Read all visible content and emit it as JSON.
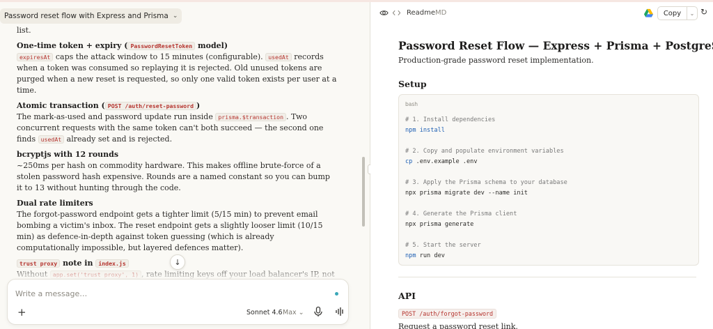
{
  "chat": {
    "title": "Password reset flow with Express and Prisma",
    "fragment": "list.",
    "sections": [
      {
        "heading_before": "One-time token + expiry (",
        "heading_code": "PasswordResetToken",
        "heading_after": " model)",
        "body": [
          {
            "code": "expiresAt"
          },
          {
            "text": " caps the attack window to 15 minutes (configurable). "
          },
          {
            "code": "usedAt"
          },
          {
            "text": " records when a token was consumed so replaying it is rejected. Old unused tokens are purged when a new reset is requested, so only one valid token exists per user at a time."
          }
        ]
      },
      {
        "heading_before": "Atomic transaction (",
        "heading_code": "POST /auth/reset-password",
        "heading_after": ")",
        "body": [
          {
            "text": "The mark-as-used and password update run inside "
          },
          {
            "code": "prisma.$transaction"
          },
          {
            "text": ". Two concurrent requests with the same token can't both succeed — the second one finds "
          },
          {
            "code": "usedAt"
          },
          {
            "text": " already set and is rejected."
          }
        ]
      },
      {
        "heading_before": "bcryptjs with 12 rounds",
        "heading_code": "",
        "heading_after": "",
        "body": [
          {
            "text": "~250ms per hash on commodity hardware. This makes offline brute-force of a stolen password hash expensive. Rounds are a named constant so you can bump it to 13 without hunting through the code."
          }
        ]
      },
      {
        "heading_before": "Dual rate limiters",
        "heading_code": "",
        "heading_after": "",
        "body": [
          {
            "text": "The forgot-password endpoint gets a tighter limit (5/15 min) to prevent email bombing a victim's inbox. The reset endpoint gets a slightly looser limit (10/15 min) as defence-in-depth against token guessing (which is already computationally impossible, but layered defences matter)."
          }
        ]
      },
      {
        "heading_before": "",
        "heading_code": "trust proxy",
        "heading_after": " note in ",
        "heading_code2": "index.js",
        "body": [
          {
            "text": "Without "
          },
          {
            "code": "app.set('trust proxy', 1)"
          },
          {
            "text": ", rate limiting keys off your load balancer's IP, not the real client — effectively disabling it in any multi-server deployment. The comment is"
          }
        ]
      }
    ]
  },
  "composer": {
    "placeholder": "Write a message…",
    "model": "Sonnet 4.6",
    "effort": "Max"
  },
  "artifact": {
    "file_name": "Readme",
    "file_ext": "MD",
    "copy_label": "Copy",
    "title": "Password Reset Flow — Express + Prisma + PostgreSQL",
    "subtitle": "Production-grade password reset implementation.",
    "setup_heading": "Setup",
    "code_lang": "bash",
    "code_lines": [
      [
        {
          "c": "# 1. Install dependencies",
          "k": "cm"
        }
      ],
      [
        {
          "c": "npm",
          "k": "kw"
        },
        {
          "c": " install",
          "k": "kw"
        }
      ],
      [
        {
          "c": "",
          "k": ""
        }
      ],
      [
        {
          "c": "# 2. Copy and populate environment variables",
          "k": "cm"
        }
      ],
      [
        {
          "c": "cp",
          "k": "kw"
        },
        {
          "c": " .env.example .env",
          "k": ""
        }
      ],
      [
        {
          "c": "",
          "k": ""
        }
      ],
      [
        {
          "c": "# 3. Apply the Prisma schema to your database",
          "k": "cm"
        }
      ],
      [
        {
          "c": "npx prisma migrate dev --name init",
          "k": ""
        }
      ],
      [
        {
          "c": "",
          "k": ""
        }
      ],
      [
        {
          "c": "# 4. Generate the Prisma client",
          "k": "cm"
        }
      ],
      [
        {
          "c": "npx prisma generate",
          "k": ""
        }
      ],
      [
        {
          "c": "",
          "k": ""
        }
      ],
      [
        {
          "c": "# 5. Start the server",
          "k": "cm"
        }
      ],
      [
        {
          "c": "npm",
          "k": "kw"
        },
        {
          "c": " run dev",
          "k": ""
        }
      ]
    ],
    "api_heading": "API",
    "endpoint": "POST /auth/forgot-password",
    "endpoint_desc": "Request a password reset link."
  }
}
